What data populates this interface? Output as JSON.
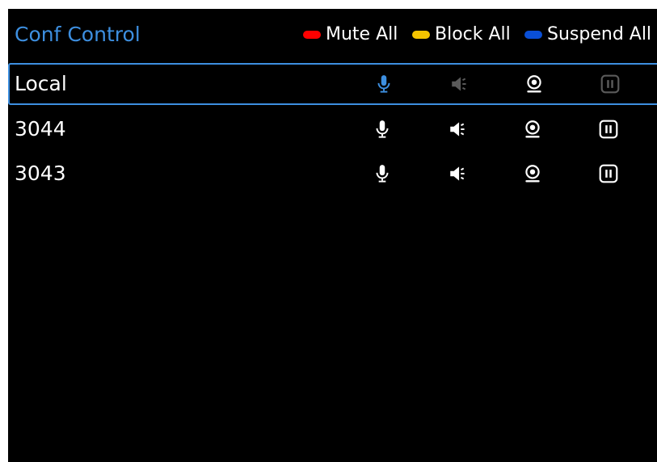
{
  "header": {
    "title": "Conf Control",
    "legend": [
      {
        "label": "Mute All",
        "color": "#ff0000",
        "icon": "red-pill-indicator"
      },
      {
        "label": "Block All",
        "color": "#f5c400",
        "icon": "yellow-pill-indicator"
      },
      {
        "label": "Suspend All",
        "color": "#0a4fd6",
        "icon": "blue-pill-indicator"
      }
    ]
  },
  "colors": {
    "accent": "#3d8fe0",
    "background": "#000000",
    "icon_active": "#ffffff",
    "icon_disabled": "#5a5a5a"
  },
  "participants": [
    {
      "name": "Local",
      "selected": true,
      "controls": {
        "mic": "active-blue",
        "speaker": "disabled",
        "camera": "enabled",
        "suspend": "disabled"
      }
    },
    {
      "name": "3044",
      "selected": false,
      "controls": {
        "mic": "enabled",
        "speaker": "enabled",
        "camera": "enabled",
        "suspend": "enabled"
      }
    },
    {
      "name": "3043",
      "selected": false,
      "controls": {
        "mic": "enabled",
        "speaker": "enabled",
        "camera": "enabled",
        "suspend": "enabled"
      }
    }
  ]
}
